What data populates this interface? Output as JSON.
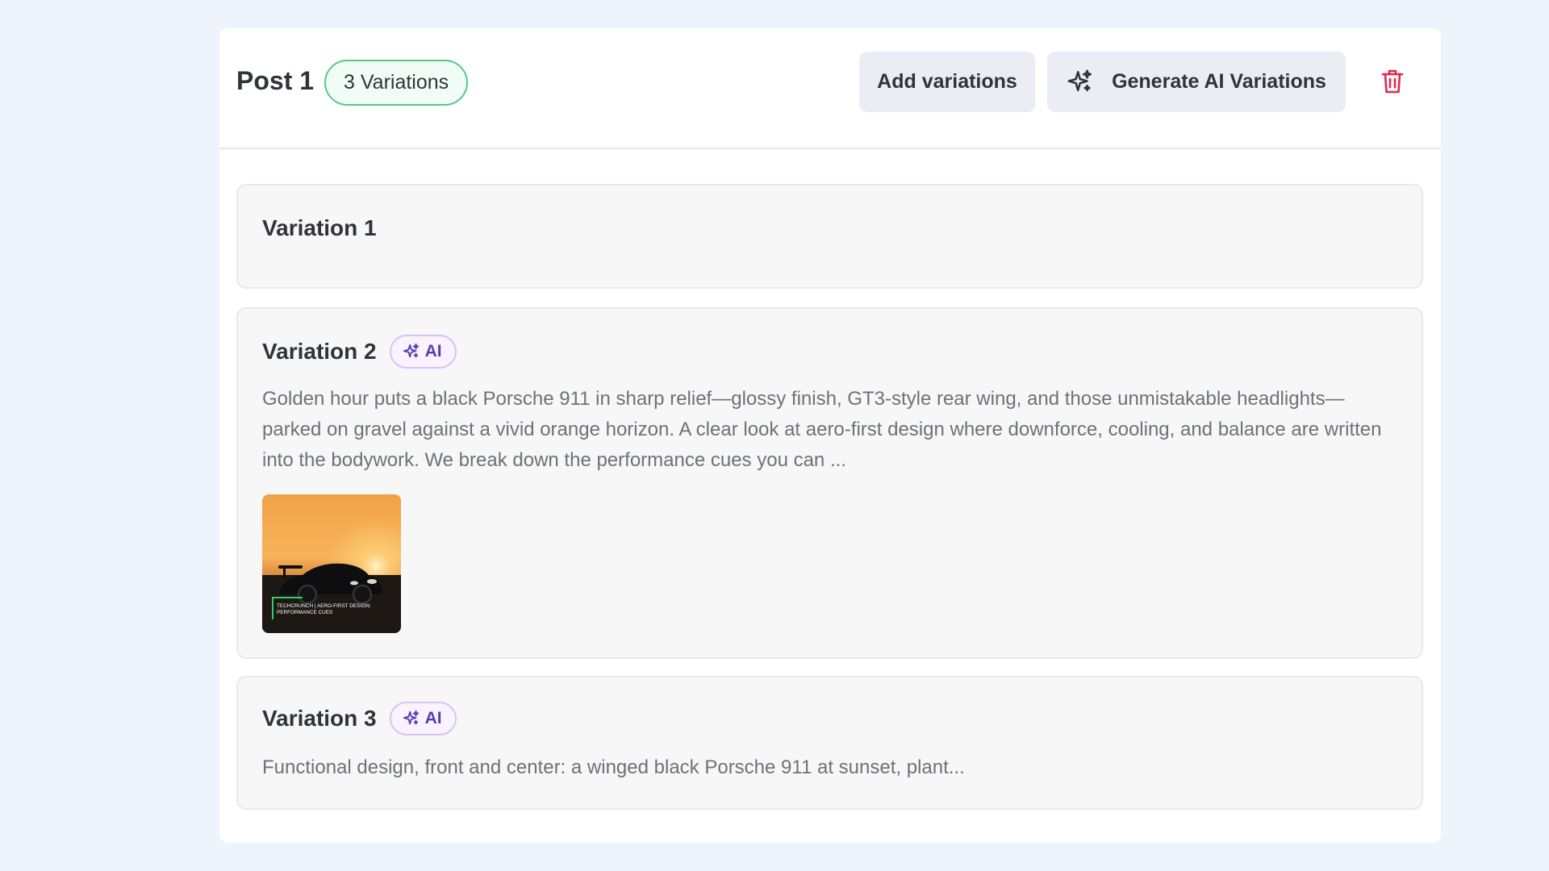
{
  "post": {
    "title": "Post 1",
    "variations_badge": "3 Variations",
    "add_variations_label": "Add variations",
    "generate_ai_label": "Generate AI Variations"
  },
  "variations": [
    {
      "title": "Variation 1",
      "ai": false,
      "text": ""
    },
    {
      "title": "Variation 2",
      "ai": true,
      "ai_label": "AI",
      "text": "Golden hour puts a black Porsche 911 in sharp relief—glossy finish, GT3-style rear wing, and those unmistakable headlights—parked on gravel against a vivid orange horizon. A clear look at aero-first design where downforce, cooling, and balance are written into the bodywork. We break down the performance cues you can ...",
      "image": {
        "overlay_line1": "TECHCRUNCH | AERO-FIRST DESIGN:",
        "overlay_line2": "PERFORMANCE CUES"
      }
    },
    {
      "title": "Variation 3",
      "ai": true,
      "ai_label": "AI",
      "text": "Functional design, front and center: a winged black Porsche 911 at sunset, plant..."
    }
  ],
  "colors": {
    "page_bg": "#edf4fc",
    "badge_green": "#54c98a",
    "ai_purple": "#5b3bb5",
    "delete_red": "#e5284f"
  },
  "icons": {
    "generate": "sparkle-icon",
    "delete": "trash-icon",
    "ai": "sparkle-icon"
  }
}
